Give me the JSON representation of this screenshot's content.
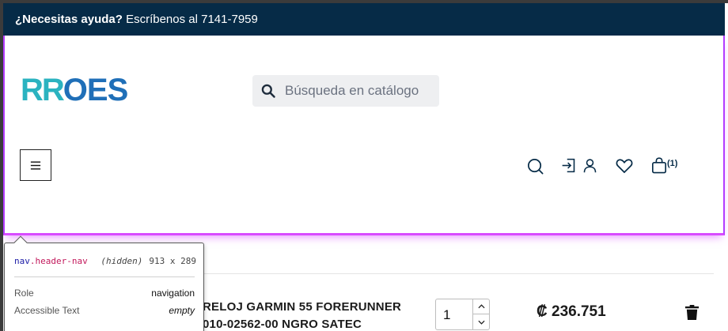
{
  "topbar": {
    "help_bold": "¿Necesitas ayuda?",
    "help_text": " Escríbenos al 7141-7959"
  },
  "logo": {
    "part1": "RR",
    "part2": "OES"
  },
  "search": {
    "placeholder": "Búsqueda en catálogo"
  },
  "header": {
    "cart_count": "(1)",
    "icons": [
      "menu-icon",
      "search-icon",
      "login-icon",
      "user-icon",
      "heart-icon",
      "cart-icon"
    ]
  },
  "cart_item": {
    "name_line1": "RELOJ GARMIN 55 FORERUNNER",
    "name_line2": "010-02562-00 NGRO SATEC",
    "quantity": "1",
    "price": "₡ 236.751"
  },
  "inspector": {
    "tag": "nav",
    "class": ".header-nav",
    "state": "(hidden)",
    "size": "913 x 289",
    "role_label": "Role",
    "role_value": "navigation",
    "accessible_label": "Accessible Text",
    "accessible_value": "empty"
  },
  "colors": {
    "topbar_bg": "#062b47",
    "logo_teal": "#2bb3c0",
    "logo_blue": "#1f6fb8",
    "highlight": "#d84bff"
  }
}
